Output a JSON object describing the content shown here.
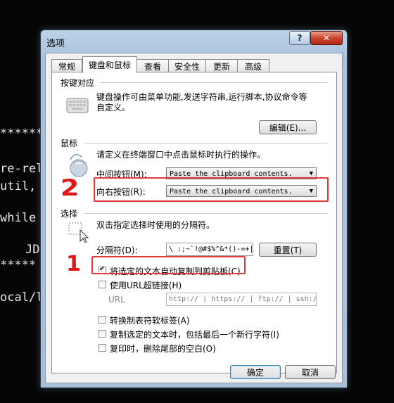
{
  "terminal": {
    "lines": [
      "******",
      "re-rel",
      "util,",
      "while",
      "JD",
      "*****",
      "ocal/l"
    ]
  },
  "dialog": {
    "title": "选项",
    "help_label": "?",
    "close_label": "✕",
    "tabs": [
      {
        "label": "常规",
        "active": false
      },
      {
        "label": "键盘和鼠标",
        "active": true
      },
      {
        "label": "查看",
        "active": false
      },
      {
        "label": "安全性",
        "active": false
      },
      {
        "label": "更新",
        "active": false
      },
      {
        "label": "高级",
        "active": false
      }
    ],
    "keybinding": {
      "heading": "按键对应",
      "desc_line1": "键盘操作可由菜单功能,发送字符串,运行脚本,协议命令等",
      "desc_line2": "自定义。",
      "edit_button": "编辑(E)..."
    },
    "mouse": {
      "heading": "鼠标",
      "desc": "请定义在终端窗口中点击鼠标时执行的操作。",
      "middle_label": "中间按钮(M):",
      "middle_value": "Paste the clipboard contents.",
      "right_label": "向右按钮(R):",
      "right_value": "Paste the clipboard contents."
    },
    "selection": {
      "heading": "选择",
      "desc": "双击指定选择时使用的分隔符。",
      "delim_label": "分隔符(D):",
      "delim_value": "\\ :;~`!@#$%^&*()-=+|",
      "reset_button": "重置(T)",
      "auto_copy_label": "将选定的文本自动复制到剪贴板(C)",
      "auto_copy_checked": true,
      "url_link_label": "使用URL超链接(H)",
      "url_link_checked": false,
      "url_label": "URL",
      "url_value": "http:// | https:// | ftp:// | ssh://",
      "tab_to_space_label": "转换制表符软标签(A)",
      "tab_to_space_checked": false,
      "copy_newline_label": "复制选定的文本时，包括最后一个新行字符(I)",
      "copy_newline_checked": false,
      "trim_trailing_label": "复印时，删除尾部的空白(O)",
      "trim_trailing_checked": false
    },
    "ok_button": "确定",
    "cancel_button": "取消"
  },
  "annotations": {
    "mark_1": "1",
    "mark_2": "2",
    "color": "#e23a3a"
  }
}
